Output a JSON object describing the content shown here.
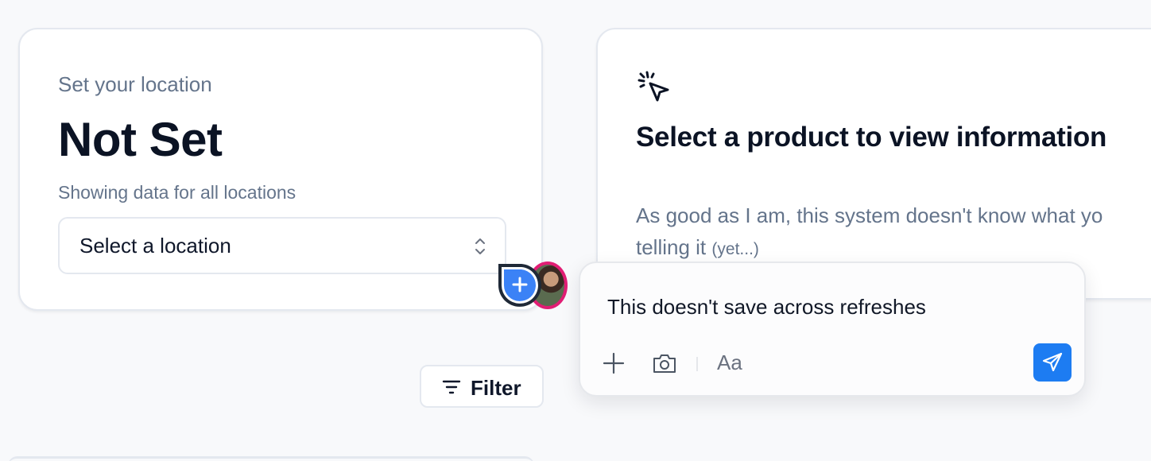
{
  "location_card": {
    "eyebrow": "Set your location",
    "title": "Not Set",
    "subtitle": "Showing data for all locations",
    "select": {
      "value": "Select a location",
      "icon": "chevron-up-down-icon"
    }
  },
  "product_card": {
    "icon": "cursor-click-icon",
    "title": "Select a product to view information",
    "description": "As good as I am, this system doesn't know what yo",
    "description_line2": "telling it",
    "description_aside": "(yet...)"
  },
  "filter": {
    "label": "Filter",
    "icon": "filter-lines-icon"
  },
  "comment": {
    "pin_icon": "plus-icon",
    "text": "This doesn't save across refreshes",
    "toolbar": {
      "add_icon": "plus-icon",
      "camera_icon": "camera-icon",
      "format_label": "Aa",
      "send_icon": "send-icon"
    }
  },
  "colors": {
    "accent": "#1d7cf2",
    "pin_blue": "#3b82f6",
    "avatar_ring": "#e11d74",
    "muted_text": "#64748b"
  }
}
